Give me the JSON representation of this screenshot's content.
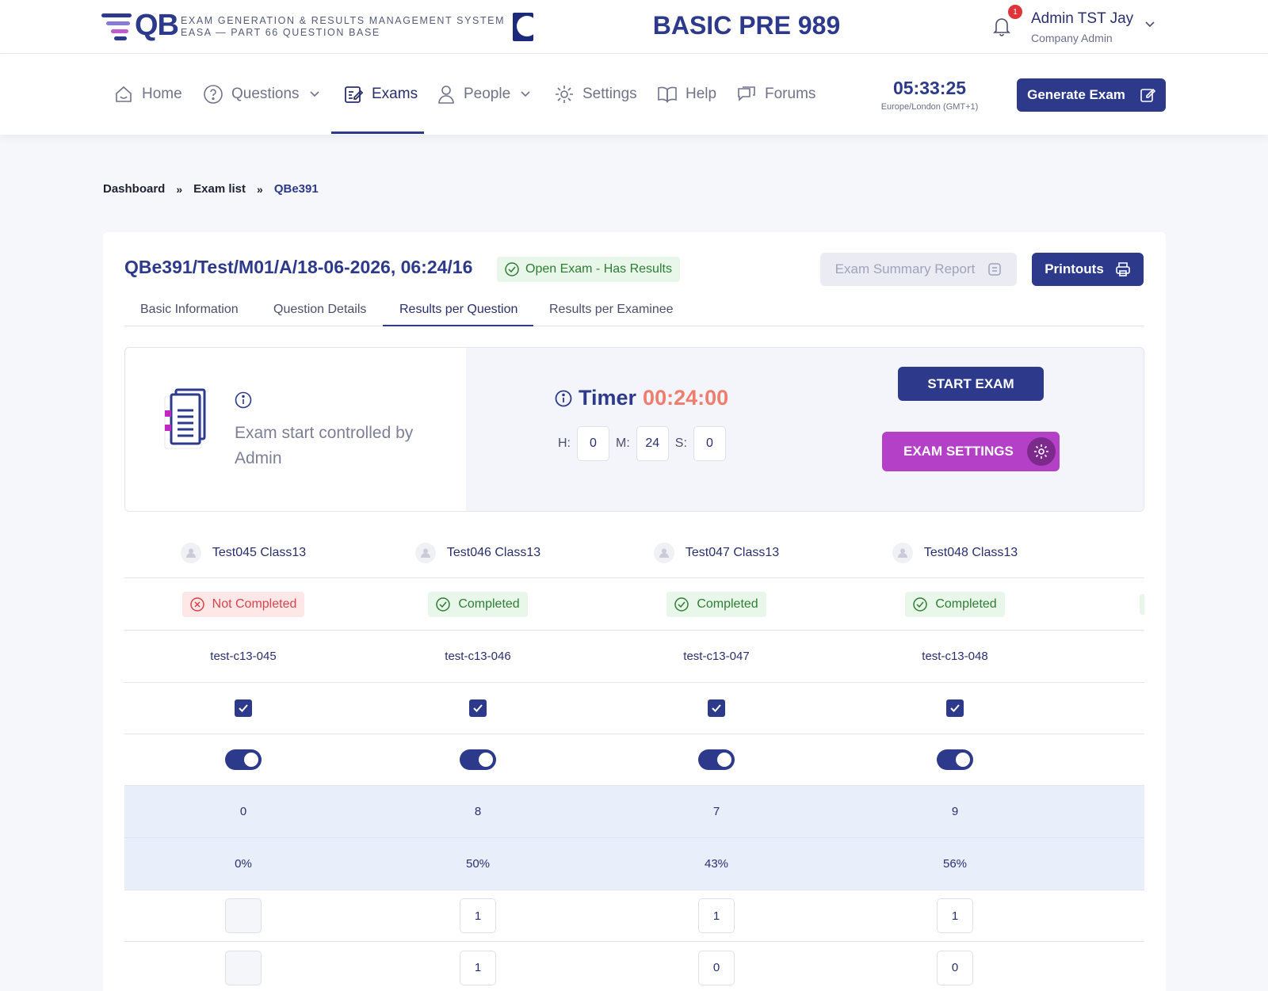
{
  "header": {
    "logo_text": "QB",
    "system_line1": "EXAM GENERATION & RESULTS MANAGEMENT SYSTEM",
    "system_line2": "EASA — PART 66 QUESTION BASE",
    "app_title": "BASIC PRE 989",
    "notification_count": "1",
    "user_name": "Admin TST Jay",
    "user_role": "Company Admin"
  },
  "nav": {
    "items": [
      {
        "label": "Home",
        "icon": "home-icon"
      },
      {
        "label": "Questions",
        "icon": "question-circle-icon"
      },
      {
        "label": "Exams",
        "icon": "exam-edit-icon"
      },
      {
        "label": "People",
        "icon": "person-icon"
      },
      {
        "label": "Settings",
        "icon": "gear-icon"
      },
      {
        "label": "Help",
        "icon": "book-icon"
      },
      {
        "label": "Forums",
        "icon": "chat-icon"
      }
    ],
    "active": "Exams",
    "clock_time": "05:33:25",
    "clock_tz": "Europe/London (GMT+1)",
    "generate_label": "Generate Exam"
  },
  "breadcrumb": {
    "items": [
      "Dashboard",
      "Exam list",
      "QBe391"
    ],
    "separator": "»"
  },
  "exam": {
    "title": "QBe391/Test/M01/A/18-06-2026, 06:24/16",
    "status": "Open Exam - Has Results",
    "summary_label": "Exam Summary Report",
    "printouts_label": "Printouts",
    "tabs": [
      "Basic Information",
      "Question Details",
      "Results per Question",
      "Results per Examinee"
    ],
    "active_tab": "Results per Question"
  },
  "control": {
    "start_text": "Exam start controlled by Admin",
    "timer_label": "Timer",
    "timer_value": "00:24:00",
    "h_label": "H:",
    "h_value": "0",
    "m_label": "M:",
    "m_value": "24",
    "s_label": "S:",
    "s_value": "0",
    "start_button": "START EXAM",
    "settings_button": "EXAM SETTINGS"
  },
  "examinees": [
    {
      "name": "Test045 Class13",
      "status": "Not Completed",
      "status_type": "error",
      "code": "test-c13-045",
      "checked": true,
      "enabled": true,
      "score": "0",
      "percent": "0%",
      "q1": "",
      "q2": ""
    },
    {
      "name": "Test046 Class13",
      "status": "Completed",
      "status_type": "success",
      "code": "test-c13-046",
      "checked": true,
      "enabled": true,
      "score": "8",
      "percent": "50%",
      "q1": "1",
      "q2": "1"
    },
    {
      "name": "Test047 Class13",
      "status": "Completed",
      "status_type": "success",
      "code": "test-c13-047",
      "checked": true,
      "enabled": true,
      "score": "7",
      "percent": "43%",
      "q1": "1",
      "q2": "0"
    },
    {
      "name": "Test048 Class13",
      "status": "Completed",
      "status_type": "success",
      "code": "test-c13-048",
      "checked": true,
      "enabled": true,
      "score": "9",
      "percent": "56%",
      "q1": "1",
      "q2": "0"
    }
  ],
  "colors": {
    "primary": "#2d3a8c",
    "accent_purple": "#b540c8",
    "timer_red": "#ef7d6e",
    "success_bg": "#e8f7ea",
    "error_bg": "#fde7e7"
  }
}
